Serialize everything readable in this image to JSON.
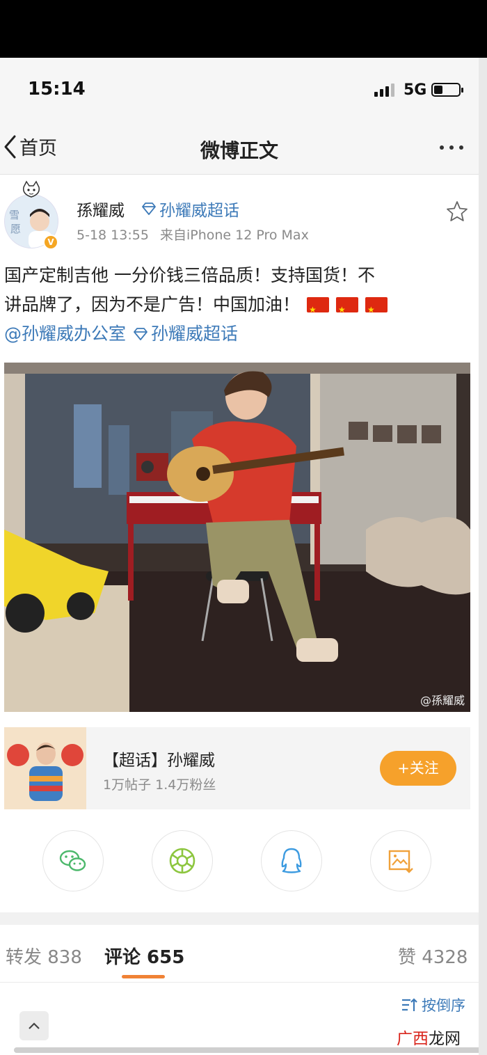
{
  "status_bar": {
    "time": "15:14",
    "network": "5G"
  },
  "nav": {
    "back_label": "首页",
    "title": "微博正文"
  },
  "post": {
    "author": "孫耀威",
    "supertopic_tag": "孙耀威超话",
    "timestamp": "5-18 13:55",
    "source": "来自iPhone 12 Pro Max",
    "text_line1": "国产定制吉他 一分价钱三倍品质！支持国货！不",
    "text_line2": "讲品牌了，因为不是广告！中国加油！",
    "mention": "@孙耀威办公室",
    "topic_link": "孙耀威超话",
    "image_watermark": "@孫耀威",
    "verified_mark": "V"
  },
  "supertopic_card": {
    "name": "【超话】孙耀威",
    "stats": "1万帖子 1.4万粉丝",
    "follow_label": "+关注"
  },
  "share_icons": [
    "wechat-icon",
    "moments-icon",
    "qq-icon",
    "save-image-icon"
  ],
  "tabs": {
    "repost": "转发 838",
    "comment": "评论 655",
    "like": "赞 4328"
  },
  "sort_label": "按倒序",
  "watermark_site": {
    "part1": "广西",
    "part2": "龙网"
  },
  "colors": {
    "link": "#3d7ab8",
    "accent_orange": "#f6a12b",
    "tab_underline": "#f08235"
  }
}
